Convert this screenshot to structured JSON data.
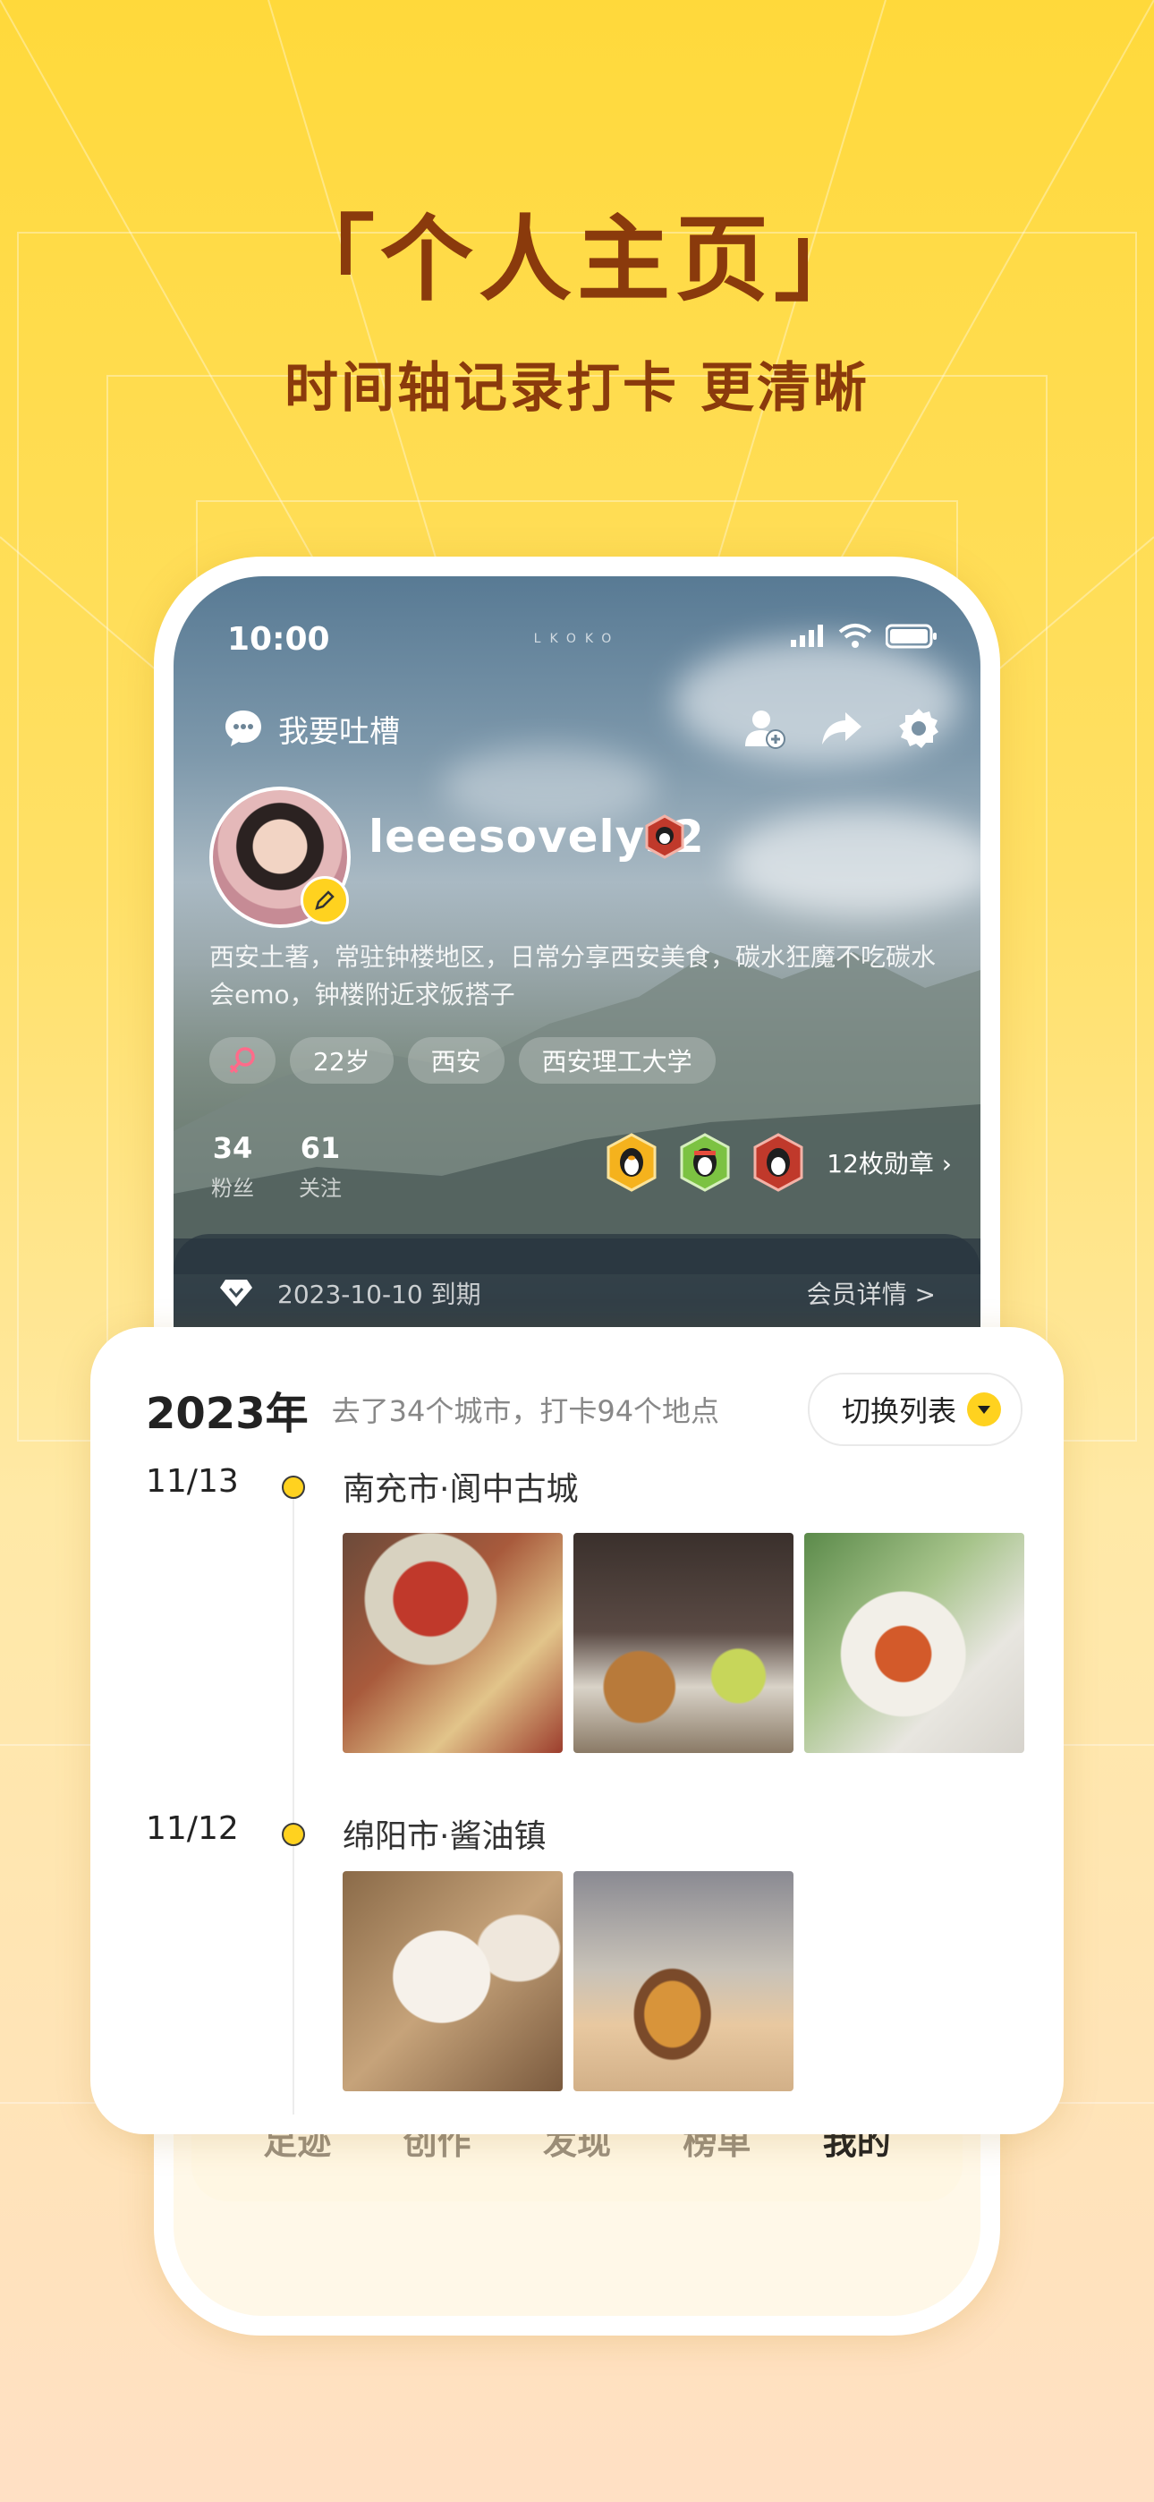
{
  "promo": {
    "headline": "「个人主页」",
    "subline": "时间轴记录打卡 更清晰"
  },
  "status_bar": {
    "time": "10:00",
    "brand": "LKOKO"
  },
  "profile": {
    "complain_label": "我要吐槽",
    "username": "leeesovelys2",
    "bio": "西安土著，常驻钟楼地区，日常分享西安美食，碳水狂魔不吃碳水会emo，钟楼附近求饭搭子",
    "tags": [
      "22岁",
      "西安",
      "西安理工大学"
    ],
    "stats": [
      {
        "value": "34",
        "label": "粉丝"
      },
      {
        "value": "61",
        "label": "关注"
      }
    ],
    "badges_label": "12枚勋章 ›"
  },
  "vip": {
    "expiry": "2023-10-10 到期",
    "details_link": "会员详情 >"
  },
  "timeline": {
    "year": "2023年",
    "summary": "去了34个城市，打卡94个地点",
    "switch_label": "切换列表",
    "entries": [
      {
        "date": "11/13",
        "place": "南充市·阆中古城"
      },
      {
        "date": "11/12",
        "place": "绵阳市·酱油镇"
      }
    ]
  },
  "tabbar": {
    "tabs": [
      "足迹",
      "创作",
      "发现",
      "榜单",
      "我的"
    ],
    "active_index": 4
  },
  "colors": {
    "accent_yellow": "#ffd21f",
    "headline_brown": "#8a3a0c"
  }
}
